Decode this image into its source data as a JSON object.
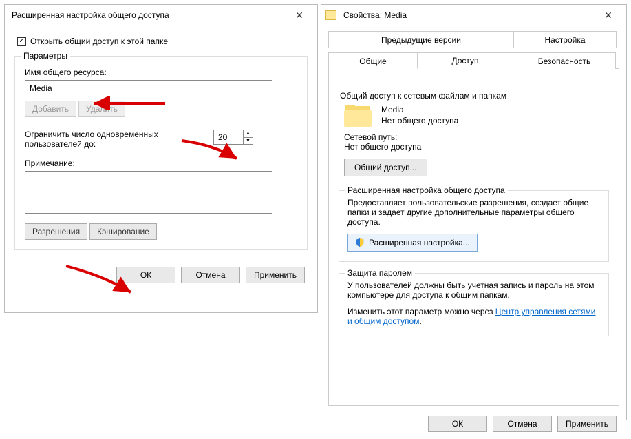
{
  "left": {
    "title": "Расширенная настройка общего доступа",
    "open_share_checkbox": "Открыть общий доступ к этой папке",
    "checked": true,
    "params_legend": "Параметры",
    "share_name_label": "Имя общего ресурса:",
    "share_name_value": "Media",
    "add_btn": "Добавить",
    "delete_btn": "Удалить",
    "limit_label": "Ограничить число одновременных пользователей до:",
    "limit_value": "20",
    "note_label": "Примечание:",
    "permissions_btn": "Разрешения",
    "caching_btn": "Кэширование",
    "ok": "ОК",
    "cancel": "Отмена",
    "apply": "Применить"
  },
  "right": {
    "title": "Свойства: Media",
    "tabs": {
      "prev_versions": "Предыдущие версии",
      "settings": "Настройка",
      "general": "Общие",
      "access": "Доступ",
      "security": "Безопасность"
    },
    "network_section_legend": "Общий доступ к сетевым файлам и папкам",
    "folder_name": "Media",
    "folder_status": "Нет общего доступа",
    "net_path_label": "Сетевой путь:",
    "net_path_value": "Нет общего доступа",
    "share_btn": "Общий доступ...",
    "adv_section_legend": "Расширенная настройка общего доступа",
    "adv_desc": "Предоставляет пользовательские разрешения, создает общие папки и задает другие дополнительные параметры общего доступа.",
    "adv_btn": "Расширенная настройка...",
    "pwd_section_legend": "Защита паролем",
    "pwd_desc": "У пользователей должны быть учетная запись и пароль на этом компьютере для доступа к общим папкам.",
    "pwd_change_prefix": "Изменить этот параметр можно через ",
    "pwd_link": "Центр управления сетями и общим доступом",
    "ok": "ОК",
    "cancel": "Отмена",
    "apply": "Применить"
  }
}
